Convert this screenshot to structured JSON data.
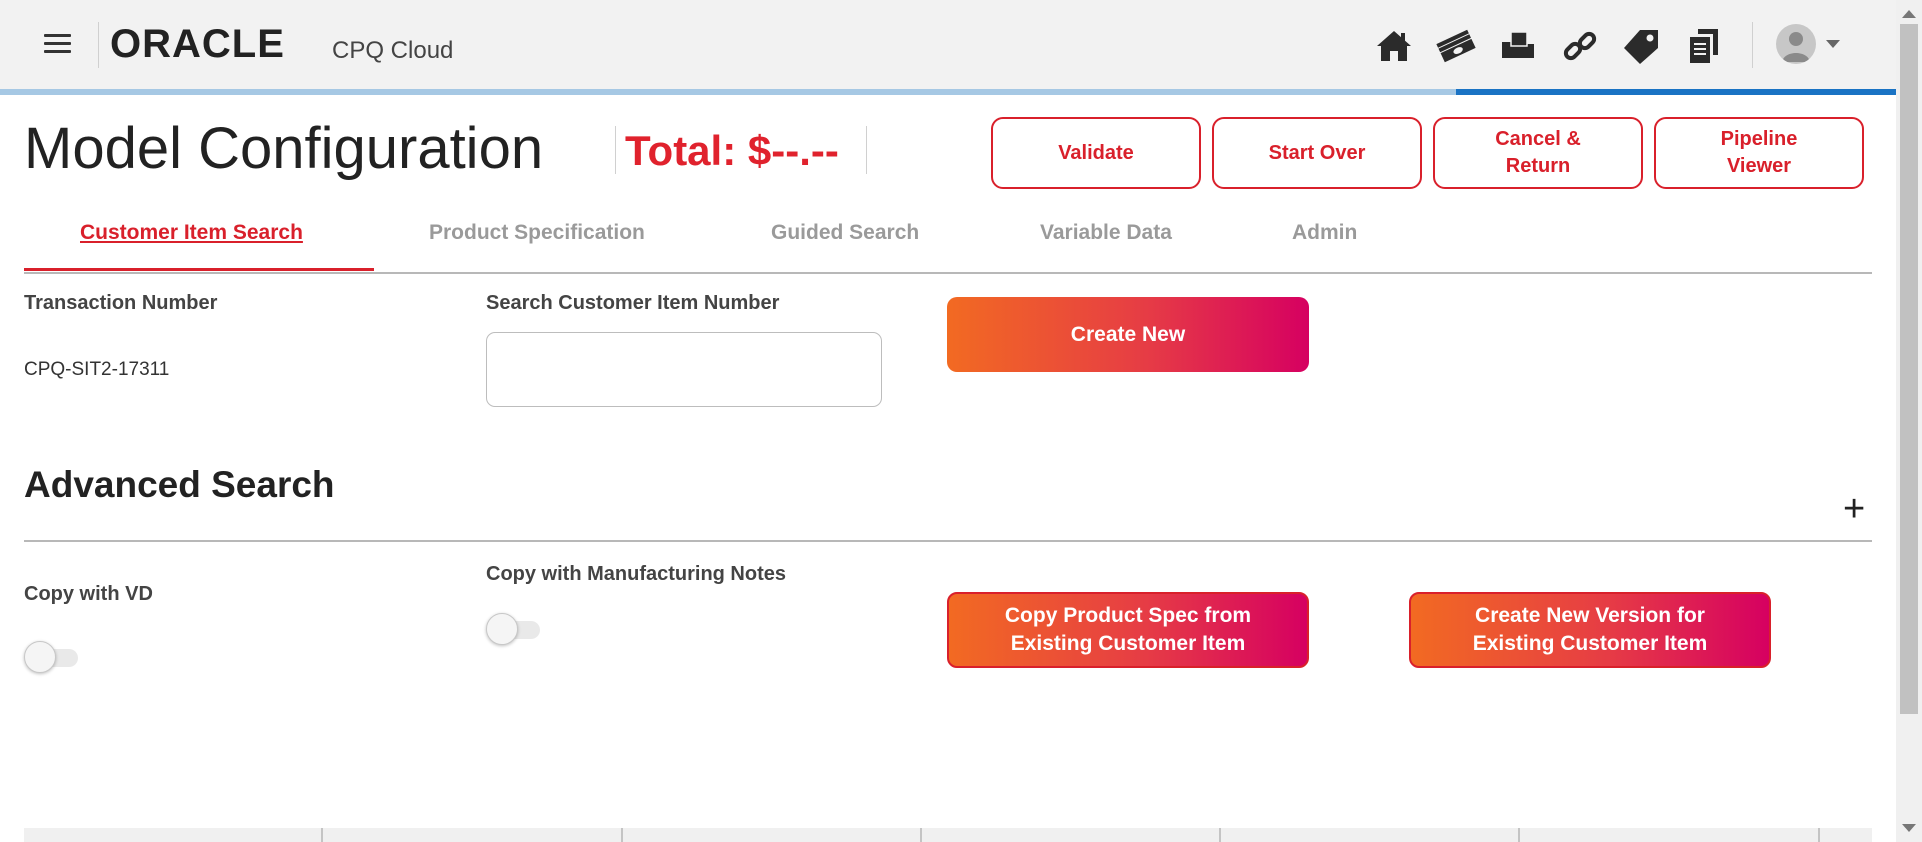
{
  "header": {
    "brand": "ORACLE",
    "product": "CPQ Cloud",
    "icons": [
      "menu-icon",
      "home-icon",
      "money-icon",
      "products-icon",
      "link-icon",
      "tag-icon",
      "documents-icon",
      "user-avatar-icon",
      "dropdown-caret-icon"
    ]
  },
  "page": {
    "title": "Model Configuration",
    "total": "Total: $--.--"
  },
  "actions": {
    "validate": "Validate",
    "start_over": "Start Over",
    "cancel_return": "Cancel & Return",
    "pipeline_viewer": "Pipeline Viewer"
  },
  "tabs": [
    {
      "label": "Customer Item Search",
      "active": true
    },
    {
      "label": "Product Specification",
      "active": false
    },
    {
      "label": "Guided Search",
      "active": false
    },
    {
      "label": "Variable Data",
      "active": false
    },
    {
      "label": "Admin",
      "active": false
    }
  ],
  "form": {
    "transaction_label": "Transaction Number",
    "transaction_value": "CPQ-SIT2-17311",
    "search_label": "Search Customer Item Number",
    "search_value": "",
    "create_new": "Create New"
  },
  "advanced": {
    "title": "Advanced Search",
    "expand_symbol": "+",
    "copy_vd_label": "Copy with VD",
    "copy_vd_on": false,
    "copy_mfg_label": "Copy with Manufacturing Notes",
    "copy_mfg_on": false,
    "copy_spec_button": "Copy Product Spec from Existing Customer Item",
    "create_version_button": "Create New Version for Existing Customer Item"
  },
  "colors": {
    "accent_red": "#d9202b",
    "gradient_start": "#f26a22",
    "gradient_end": "#d60061",
    "progress_blue": "#1a73c4"
  }
}
